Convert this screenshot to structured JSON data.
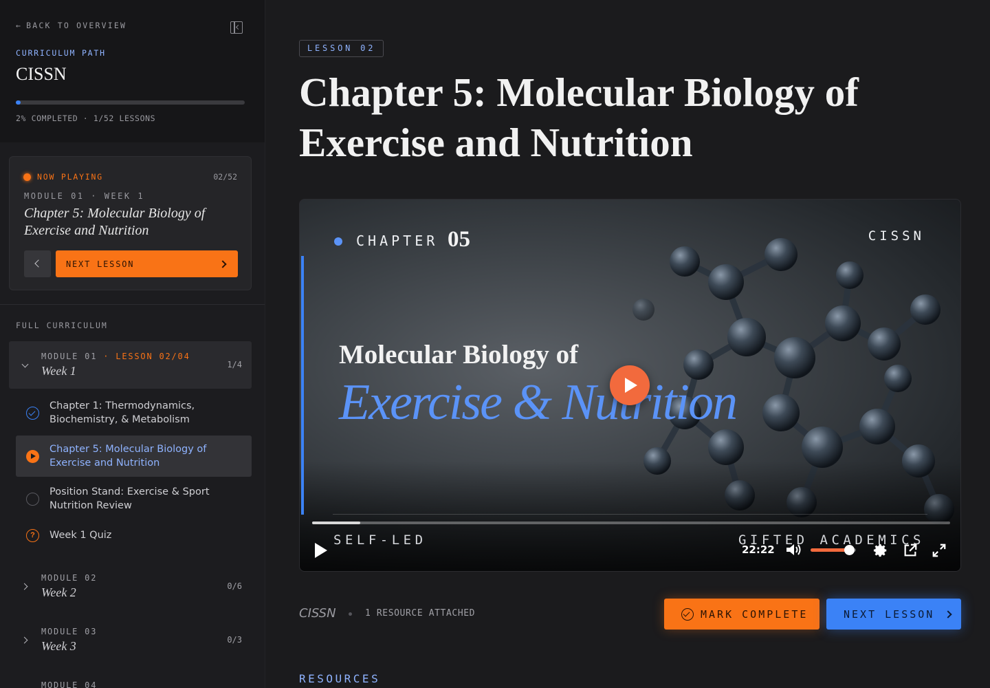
{
  "sidebar": {
    "back_label": "BACK TO OVERVIEW",
    "curriculum_label": "CURRICULUM PATH",
    "curriculum_title": "CISSN",
    "progress_percent": 2,
    "progress_text": "2% COMPLETED · 1/52 LESSONS",
    "now_playing": {
      "label": "NOW PLAYING",
      "count": "02/52",
      "module": "MODULE 01 · WEEK 1",
      "title": "Chapter 5: Molecular Biology of Exercise and Nutrition",
      "next_label": "NEXT LESSON"
    },
    "full_curriculum_label": "FULL CURRICULUM",
    "modules": [
      {
        "name": "MODULE 01",
        "lesson_tag": "· LESSON 02/04",
        "week": "Week 1",
        "count": "1/4",
        "open": true
      },
      {
        "name": "MODULE 02",
        "lesson_tag": "",
        "week": "Week 2",
        "count": "0/6",
        "open": false
      },
      {
        "name": "MODULE 03",
        "lesson_tag": "",
        "week": "Week 3",
        "count": "0/3",
        "open": false
      },
      {
        "name": "MODULE 04",
        "lesson_tag": "",
        "week": "",
        "count": "",
        "open": false
      }
    ],
    "lessons": [
      {
        "title": "Chapter 1: Thermodynamics, Biochemistry, & Metabolism",
        "status": "done"
      },
      {
        "title": "Chapter 5: Molecular Biology of Exercise and Nutrition",
        "status": "playing"
      },
      {
        "title": "Position Stand: Exercise & Sport Nutrition Review",
        "status": "todo"
      },
      {
        "title": "Week 1 Quiz",
        "status": "quiz"
      }
    ]
  },
  "main": {
    "lesson_pill": "LESSON 02",
    "title": "Chapter 5: Molecular Biology of Exercise and Nutrition",
    "video": {
      "chapter_label": "CHAPTER",
      "chapter_num": "05",
      "brand": "CISSN",
      "subtitle": "Molecular Biology of",
      "big_title": "Exercise & Nutrition",
      "left_caption": "SELF-LED",
      "right_caption": "GIFTED ACADEMICS",
      "time": "22:22",
      "seek_fraction": 0.075,
      "volume_fraction": 0.85
    },
    "meta_brand": "CISSN",
    "resources_attached": "1 RESOURCE ATTACHED",
    "mark_complete_label": "MARK COMPLETE",
    "next_lesson_label": "NEXT LESSON",
    "resources_heading": "RESOURCES"
  },
  "colors": {
    "accent_orange": "#f97316",
    "accent_blue": "#3b82f6",
    "background": "#1b1b1d"
  },
  "icons": [
    "arrow-left-icon",
    "sidebar-collapse-icon",
    "chevron-left-icon",
    "chevron-right-icon",
    "chevron-down-icon",
    "check-circle-icon",
    "play-circle-icon",
    "empty-circle-icon",
    "question-circle-icon",
    "play-icon",
    "volume-icon",
    "gear-icon",
    "popout-icon",
    "fullscreen-icon"
  ]
}
